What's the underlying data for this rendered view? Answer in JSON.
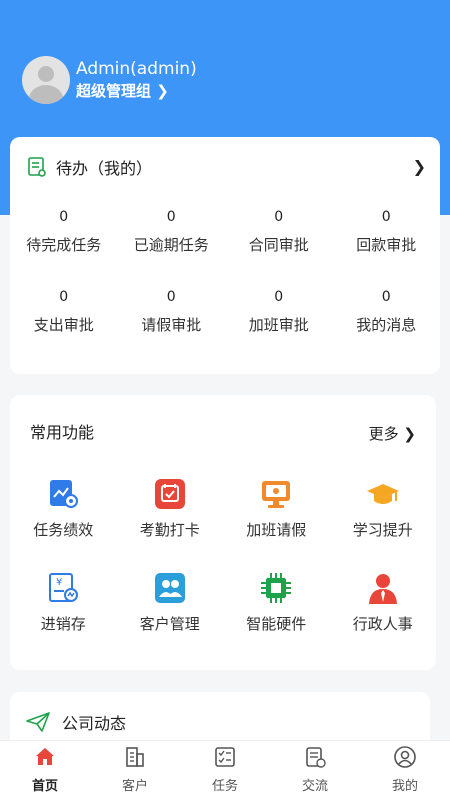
{
  "profile": {
    "name": "Admin(admin)",
    "role": "超级管理组 ❯"
  },
  "todo": {
    "title": "待办（我的）",
    "items": [
      {
        "count": "0",
        "label": "待完成任务"
      },
      {
        "count": "0",
        "label": "已逾期任务"
      },
      {
        "count": "0",
        "label": "合同审批"
      },
      {
        "count": "0",
        "label": "回款审批"
      },
      {
        "count": "0",
        "label": "支出审批"
      },
      {
        "count": "0",
        "label": "请假审批"
      },
      {
        "count": "0",
        "label": "加班审批"
      },
      {
        "count": "0",
        "label": "我的消息"
      }
    ]
  },
  "functions": {
    "title": "常用功能",
    "more_label": "更多 ❯",
    "items": [
      {
        "label": "任务绩效",
        "icon": "task-performance-icon"
      },
      {
        "label": "考勤打卡",
        "icon": "attendance-icon"
      },
      {
        "label": "加班请假",
        "icon": "overtime-leave-icon"
      },
      {
        "label": "学习提升",
        "icon": "graduation-cap-icon"
      },
      {
        "label": "进销存",
        "icon": "inventory-icon"
      },
      {
        "label": "客户管理",
        "icon": "customers-icon"
      },
      {
        "label": "智能硬件",
        "icon": "chip-icon"
      },
      {
        "label": "行政人事",
        "icon": "staff-icon"
      }
    ]
  },
  "news": {
    "title": "公司动态"
  },
  "tabbar": {
    "items": [
      {
        "label": "首页",
        "active": true
      },
      {
        "label": "客户",
        "active": false
      },
      {
        "label": "任务",
        "active": false
      },
      {
        "label": "交流",
        "active": false
      },
      {
        "label": "我的",
        "active": false
      }
    ]
  },
  "colors": {
    "header": "#3d95f7",
    "accent_red": "#e8463a",
    "blue": "#2f7be8",
    "orange": "#f5a623",
    "green": "#1fa34a"
  }
}
